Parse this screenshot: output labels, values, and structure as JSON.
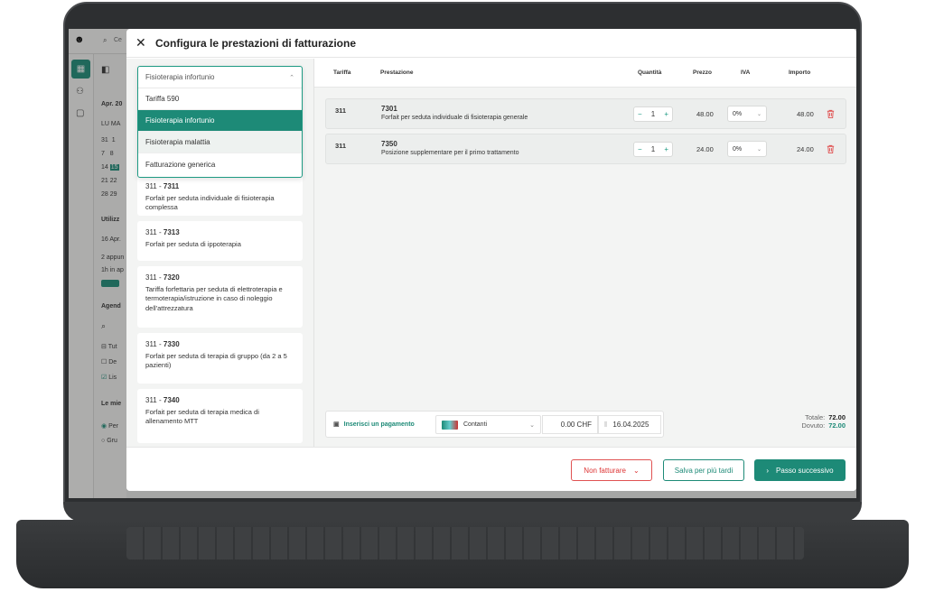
{
  "colors": {
    "accent": "#1d8a77",
    "danger": "#e05252"
  },
  "background_app": {
    "search_placeholder": "Ce",
    "date_label": "Apr. 20",
    "weekday_labels": [
      "LU",
      "MA"
    ],
    "calendar_rows": [
      [
        "31",
        "1"
      ],
      [
        "7",
        "8"
      ],
      [
        "14",
        "15"
      ],
      [
        "21",
        "22"
      ],
      [
        "28",
        "29"
      ]
    ],
    "utilization_label": "Utilizz",
    "date_line": "16 Apr.",
    "appointments": "2 appun",
    "duration": "1h in ap",
    "agenda_label": "Agend",
    "filter_tutti": "Tut",
    "filter_de": "De",
    "filter_lis": "Lis",
    "my_label": "Le mie",
    "option_per": "Per",
    "option_gru": "Gru"
  },
  "modal": {
    "title": "Configura le prestazioni di fatturazione",
    "close_icon": "close-icon"
  },
  "dropdown": {
    "selected": "Fisioterapia infortunio",
    "options": [
      "Tariffa 590",
      "Fisioterapia infortunio",
      "Fisioterapia malattia",
      "Fatturazione generica"
    ]
  },
  "services": [
    {
      "tariff": "311",
      "code": "7311",
      "description": "Forfait per seduta individuale di fisioterapia complessa"
    },
    {
      "tariff": "311",
      "code": "7313",
      "description": "Forfait per seduta di ippoterapia"
    },
    {
      "tariff": "311",
      "code": "7320",
      "description": "Tariffa forfettaria per seduta di elettroterapia e termoterapia/istruzione in caso di noleggio dell'attrezzatura"
    },
    {
      "tariff": "311",
      "code": "7330",
      "description": "Forfait per seduta di terapia di gruppo (da 2 a 5 pazienti)"
    },
    {
      "tariff": "311",
      "code": "7340",
      "description": "Forfait per seduta di terapia medica di allenamento MTT"
    }
  ],
  "table": {
    "headers": {
      "tariff": "Tariffa",
      "service": "Prestazione",
      "quantity": "Quantità",
      "price": "Prezzo",
      "vat": "IVA",
      "amount": "Importo"
    },
    "rows": [
      {
        "tariff": "311",
        "code": "7301",
        "description": "Forfait per seduta individuale di fisioterapia generale",
        "quantity": "1",
        "price": "48.00",
        "vat": "0%",
        "amount": "48.00"
      },
      {
        "tariff": "311",
        "code": "7350",
        "description": "Posizione supplementare per il primo trattamento",
        "quantity": "1",
        "price": "24.00",
        "vat": "0%",
        "amount": "24.00"
      }
    ]
  },
  "payment": {
    "insert_label": "Inserisci un pagamento",
    "method": "Contanti",
    "amount": "0.00 CHF",
    "date": "16.04.2025"
  },
  "totals": {
    "total_label": "Totale:",
    "total": "72.00",
    "due_label": "Dovuto:",
    "due": "72.00"
  },
  "footer": {
    "no_invoice": "Non fatturare",
    "save_later": "Salva per più tardi",
    "next_step": "Passo successivo"
  }
}
